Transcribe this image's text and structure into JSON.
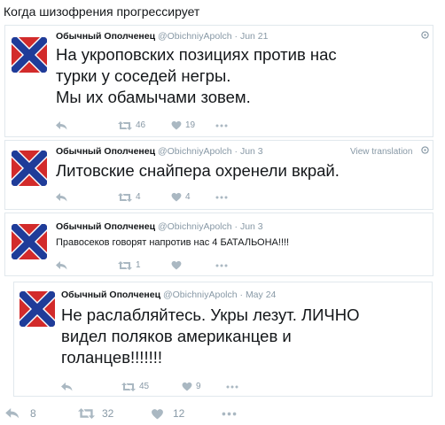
{
  "caption": "Когда шизофрения прогрессирует",
  "colors": {
    "border": "#e1e8ed",
    "muted": "#8899a6",
    "text": "#14171a",
    "flag_red": "#d22b2b",
    "flag_blue": "#1f3c99"
  },
  "tweets": [
    {
      "name": "Обычный Ополченец",
      "handle": "@ObichniyApolch",
      "sep": "·",
      "date": "Jun 21",
      "text_lines": [
        "На укроповских позициях против нас",
        "турки у соседей негры.",
        "Мы их обамычами зовем."
      ],
      "retweets": "46",
      "likes": "19"
    },
    {
      "name": "Обычный Ополченец",
      "handle": "@ObichniyApolch",
      "sep": "·",
      "date": "Jun 3",
      "view_translation": "View translation",
      "text_lines": [
        "Литовские снайпера охренели вкрай."
      ],
      "retweets": "4",
      "likes": "4"
    },
    {
      "name": "Обычный Ополченец",
      "handle": "@ObichniyApolch",
      "sep": "·",
      "date": "Jun 3",
      "text_lines": [
        "Правосеков говорят напротив нас 4 БАТАЛЬОНА!!!!"
      ],
      "retweets": "1",
      "likes": ""
    },
    {
      "name": "Обычный Ополченец",
      "handle": "@ObichniyApolch",
      "sep": "·",
      "date": "May 24",
      "text_lines": [
        "Не раслабляйтесь. Укры лезут. ЛИЧНО",
        "видел поляков американцев и",
        "голанцев!!!!!!!"
      ],
      "retweets": "45",
      "likes": "9"
    }
  ],
  "footer": {
    "replies": "8",
    "retweets": "32",
    "likes": "12"
  },
  "icons": {
    "reply": "reply-icon",
    "retweet": "retweet-icon",
    "like": "heart-icon",
    "more": "more-icon",
    "corner": "globe-icon"
  }
}
